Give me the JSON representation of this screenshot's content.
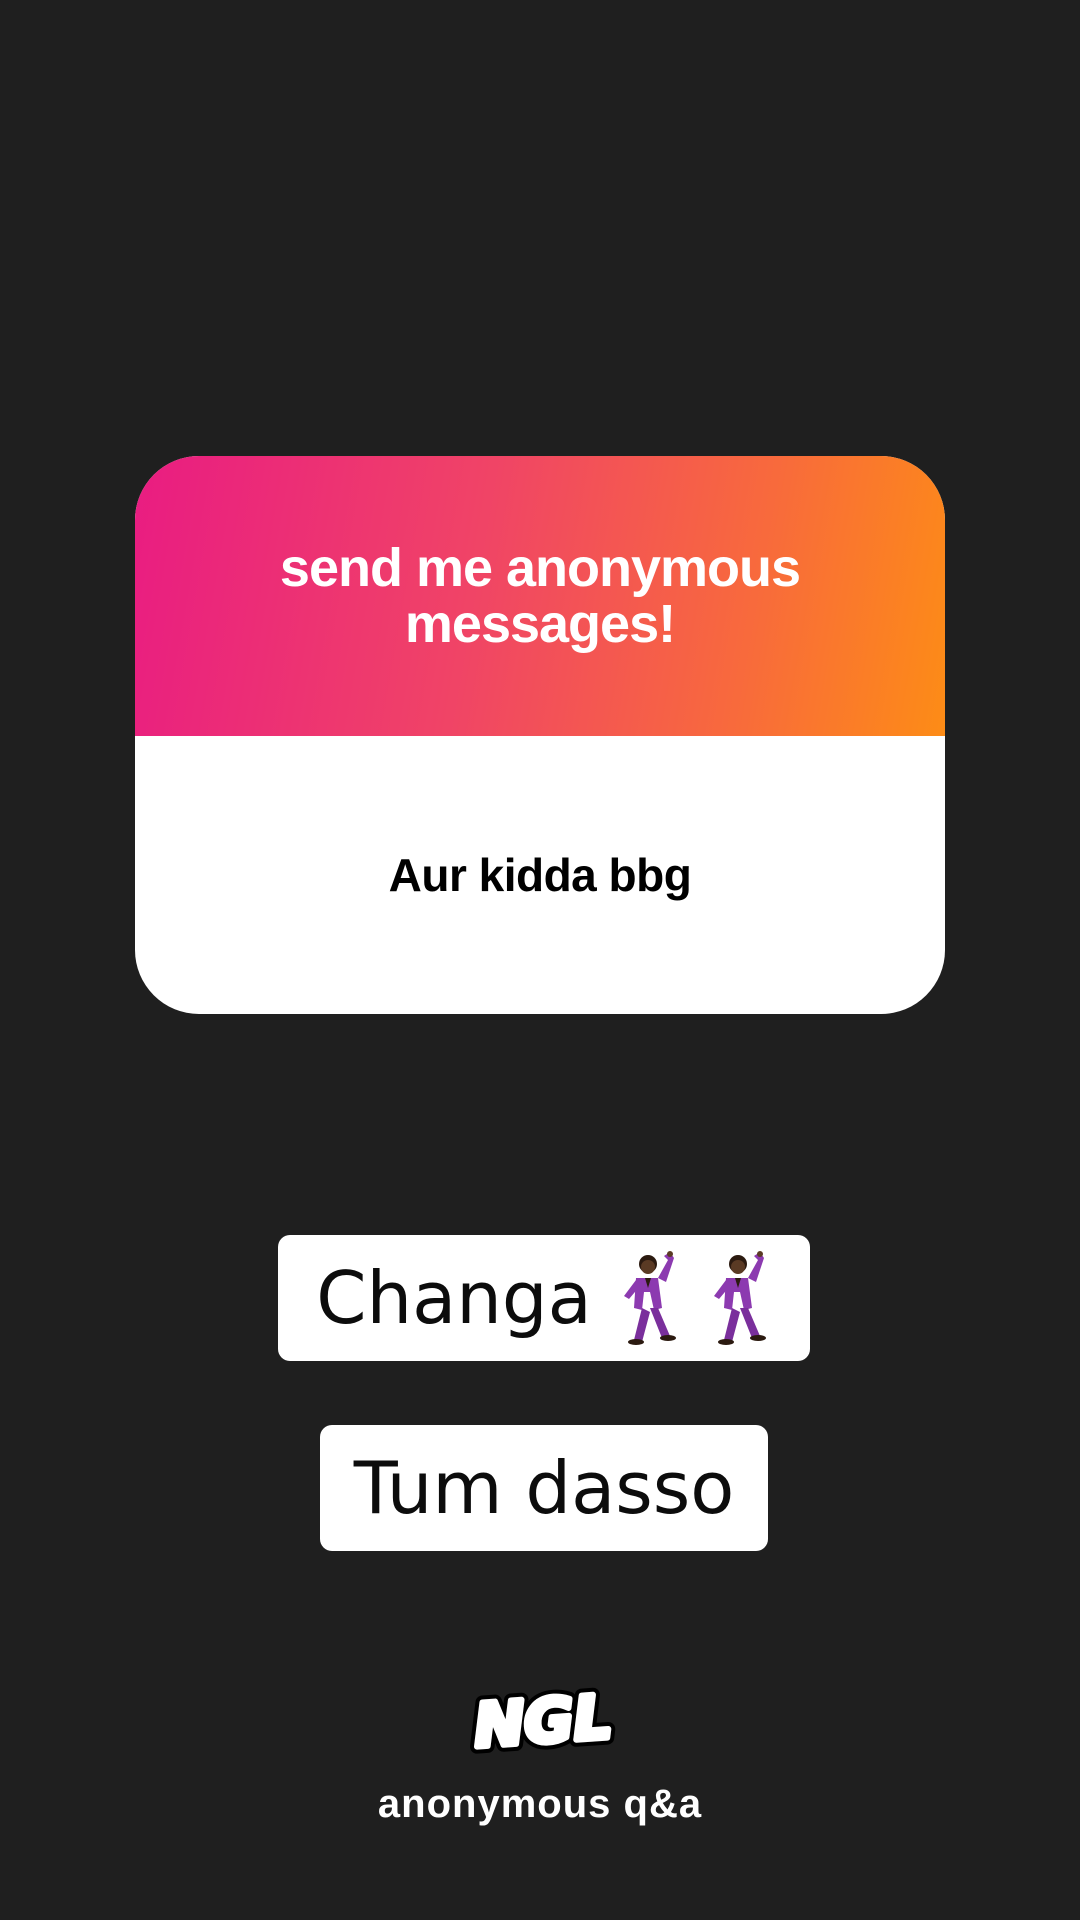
{
  "card": {
    "header_title": "send me anonymous messages!",
    "question": "Aur kidda bbg",
    "gradient_colors": [
      "#e91c82",
      "#f04466",
      "#f86a3c",
      "#fd8c16"
    ]
  },
  "replies": [
    {
      "text": "Changa",
      "icons": [
        "man-dancing-emoji-icon",
        "man-dancing-emoji-icon"
      ]
    },
    {
      "text": "Tum dasso",
      "icons": []
    }
  ],
  "branding": {
    "logo_text": "NGL",
    "caption": "anonymous q&a"
  },
  "colors": {
    "background": "#1f1f1f",
    "card_body": "#ffffff",
    "pill_background": "#ffffff",
    "text_dark": "#000000",
    "text_light": "#ffffff"
  }
}
